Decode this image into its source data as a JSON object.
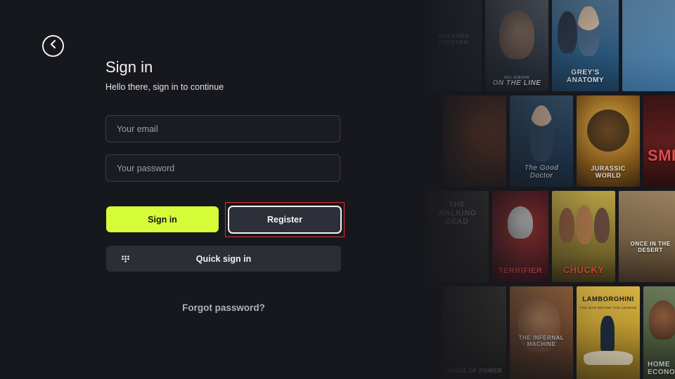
{
  "signin": {
    "title": "Sign in",
    "subtitle": "Hello there, sign in to continue",
    "email_placeholder": "Your email",
    "password_placeholder": "Your password",
    "signin_label": "Sign in",
    "register_label": "Register",
    "quick_label": "Quick sign in",
    "forgot_label": "Forgot password?"
  },
  "posters": [
    {
      "title": "WAKANDA FOREVER",
      "color": "#3a3f4a"
    },
    {
      "title": "ON THE LINE",
      "sub": "MEL GIBSON",
      "color": "#2d3a48"
    },
    {
      "title": "GREY'S ANATOMY",
      "color": "#2b5f86"
    },
    {
      "title": "",
      "color": "#5a3125"
    },
    {
      "title": "The Good Doctor",
      "color": "#263b52"
    },
    {
      "title": "JURASSIC WORLD",
      "color": "#8a5a18"
    },
    {
      "title": "SMI",
      "color": "#5e1d1d"
    },
    {
      "title": "THE WALKING DEAD",
      "color": "#3c3a34"
    },
    {
      "title": "TERRIFIER",
      "color": "#6b1f25"
    },
    {
      "title": "CHUCKY",
      "color": "#7a6a2a"
    },
    {
      "title": "ONCE IN THE DESERT",
      "color": "#7c6548"
    },
    {
      "title": "RINGS OF POWER",
      "color": "#39332a"
    },
    {
      "title": "THE INFERNAL MACHINE",
      "color": "#7a4a2e"
    },
    {
      "title": "LAMBORGHINI",
      "sub": "THE MAN BEHIND THE LEGEND",
      "color": "#c29a2c"
    },
    {
      "title": "HOME ECONOMICS",
      "color": "#4a5a3a"
    }
  ],
  "colors": {
    "background": "#17181d",
    "accent": "#d6fb38",
    "highlight_border": "#e03131"
  }
}
